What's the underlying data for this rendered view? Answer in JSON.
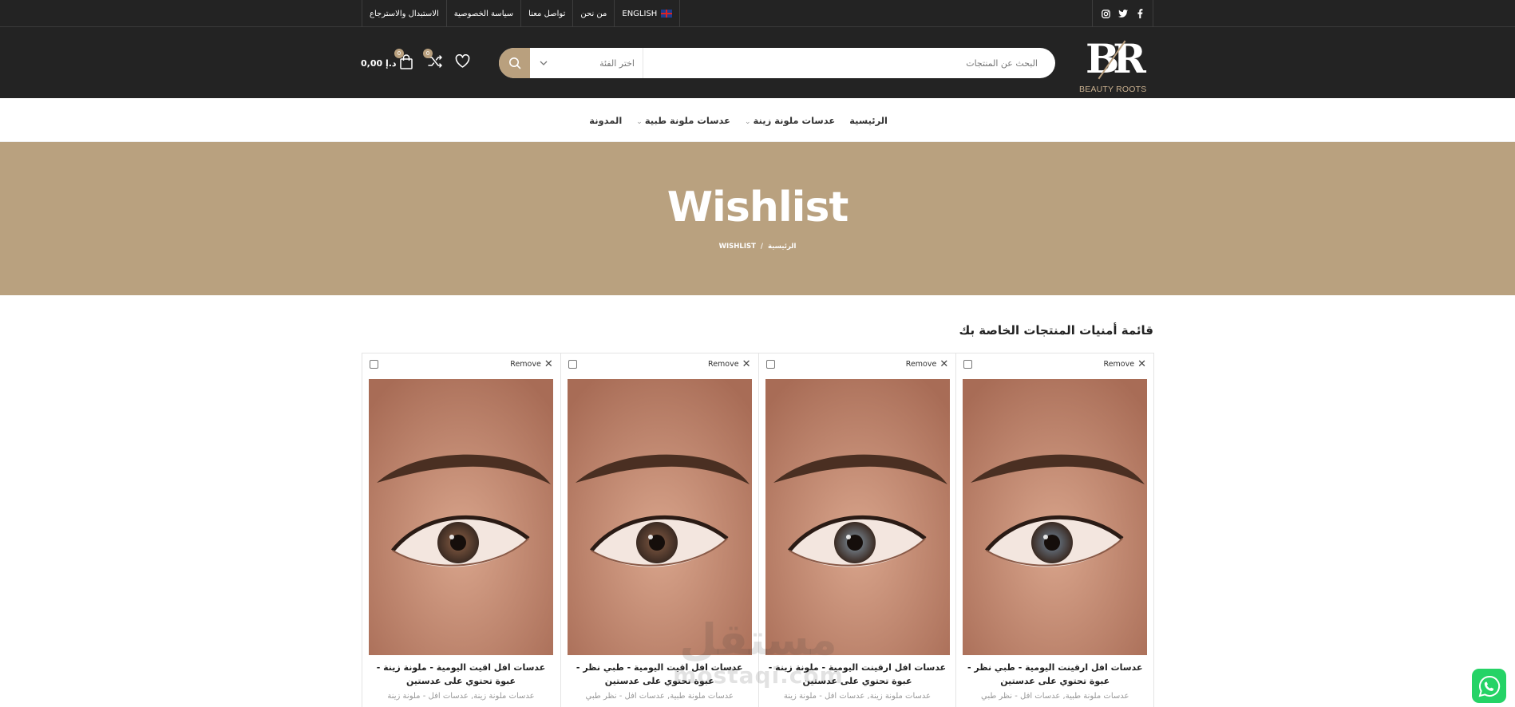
{
  "topbar": {
    "links": [
      "ENGLISH",
      "من نحن",
      "تواصل معنا",
      "سياسة الخصوصية",
      "الاستبدال والاسترجاع"
    ],
    "social_icons": [
      "facebook-icon",
      "twitter-icon",
      "instagram-icon"
    ]
  },
  "header": {
    "logo_text": "BR",
    "logo_sub": "BEAUTY ROOTS",
    "search_placeholder": "البحث عن المنتجات",
    "category_placeholder": "اختر الفئة",
    "wishlist_count": "0",
    "compare_count": "0",
    "cart_count": "0",
    "cart_total": "0,00 د.إ"
  },
  "nav": {
    "items": [
      "الرئيسية",
      "عدسات ملونة زينة",
      "عدسات ملونة طبية",
      "المدونة"
    ]
  },
  "banner": {
    "title": "Wishlist",
    "breadcrumb_home": "الرئيسية",
    "breadcrumb_sep": "/",
    "breadcrumb_current": "WISHLIST"
  },
  "content": {
    "title": "قائمة أمنيات المنتجات الخاصة بك",
    "remove_label": "Remove",
    "products": [
      {
        "name": "عدسات افل ارقينت اليومية - طبي نظر - عبوة تحتوي على عدستين",
        "cats": "عدسات ملونة طبية, عدسات افل - نظر طبي",
        "iris": "#5e6670"
      },
      {
        "name": "عدسات افل ارقينت اليومية - ملونة زينة - عبوة تحتوي على عدستين",
        "cats": "عدسات ملونة زينة, عدسات افل - ملونة زينة",
        "iris": "#6b7279"
      },
      {
        "name": "عدسات افل اقيت اليومية - طبي نظر - عبوة تحتوي على عدستين",
        "cats": "عدسات ملونة طبية, عدسات افل - نظر طبي",
        "iris": "#6a4a38"
      },
      {
        "name": "عدسات افل اقيت اليومية - ملونة زينة - عبوة تحتوي على عدستين",
        "cats": "عدسات ملونة زينة, عدسات افل - ملونة زينة",
        "iris": "#6f4d39"
      }
    ]
  },
  "watermark": {
    "ar": "مستقل",
    "en": "mostaqi.com"
  },
  "colors": {
    "dark": "#232323",
    "accent": "#b9a17f",
    "whatsapp": "#25d366"
  }
}
